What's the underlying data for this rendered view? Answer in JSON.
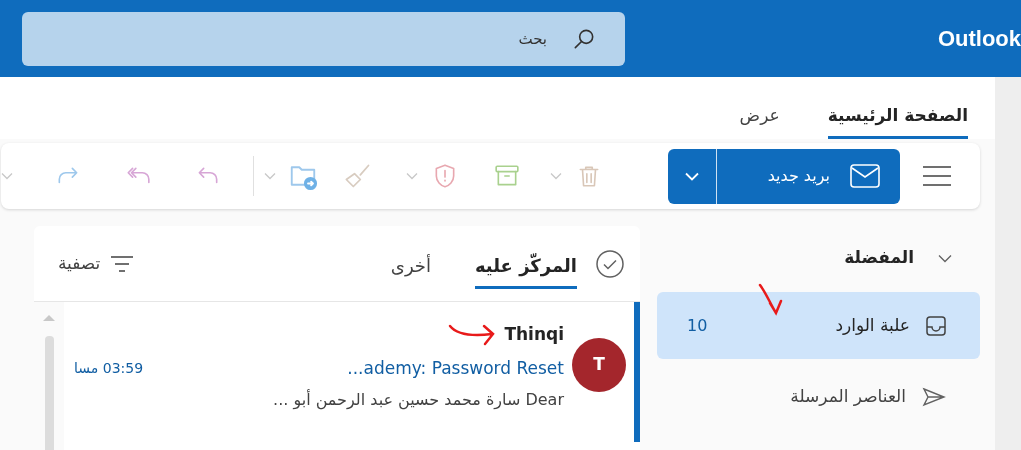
{
  "app": {
    "name": "Outlook"
  },
  "search": {
    "placeholder": "بحث"
  },
  "ribbon_tabs": [
    {
      "label": "الصفحة الرئيسية",
      "selected": true
    },
    {
      "label": "عرض",
      "selected": false
    }
  ],
  "new_mail": {
    "label": "بريد جديد"
  },
  "folders": {
    "title": "المفضلة",
    "expanded": true,
    "items": [
      {
        "kind": "inbox",
        "label": "علبة الوارد",
        "count": "10",
        "selected": true
      },
      {
        "kind": "sent",
        "label": "العناصر المرسلة",
        "selected": false
      }
    ]
  },
  "message_list": {
    "tabs": [
      {
        "label": "المركّز عليه",
        "selected": true
      },
      {
        "label": "أخرى",
        "selected": false
      }
    ],
    "filter": "تصفية",
    "messages": [
      {
        "sender": "Thinqi",
        "initial": "T",
        "color": "#a4262c",
        "subject": "...ademy: Password Reset",
        "time": "03:59 مسا",
        "preview": "Dear سارة محمد حسين عبد الرحمن أبو ...",
        "unread": true
      }
    ]
  }
}
